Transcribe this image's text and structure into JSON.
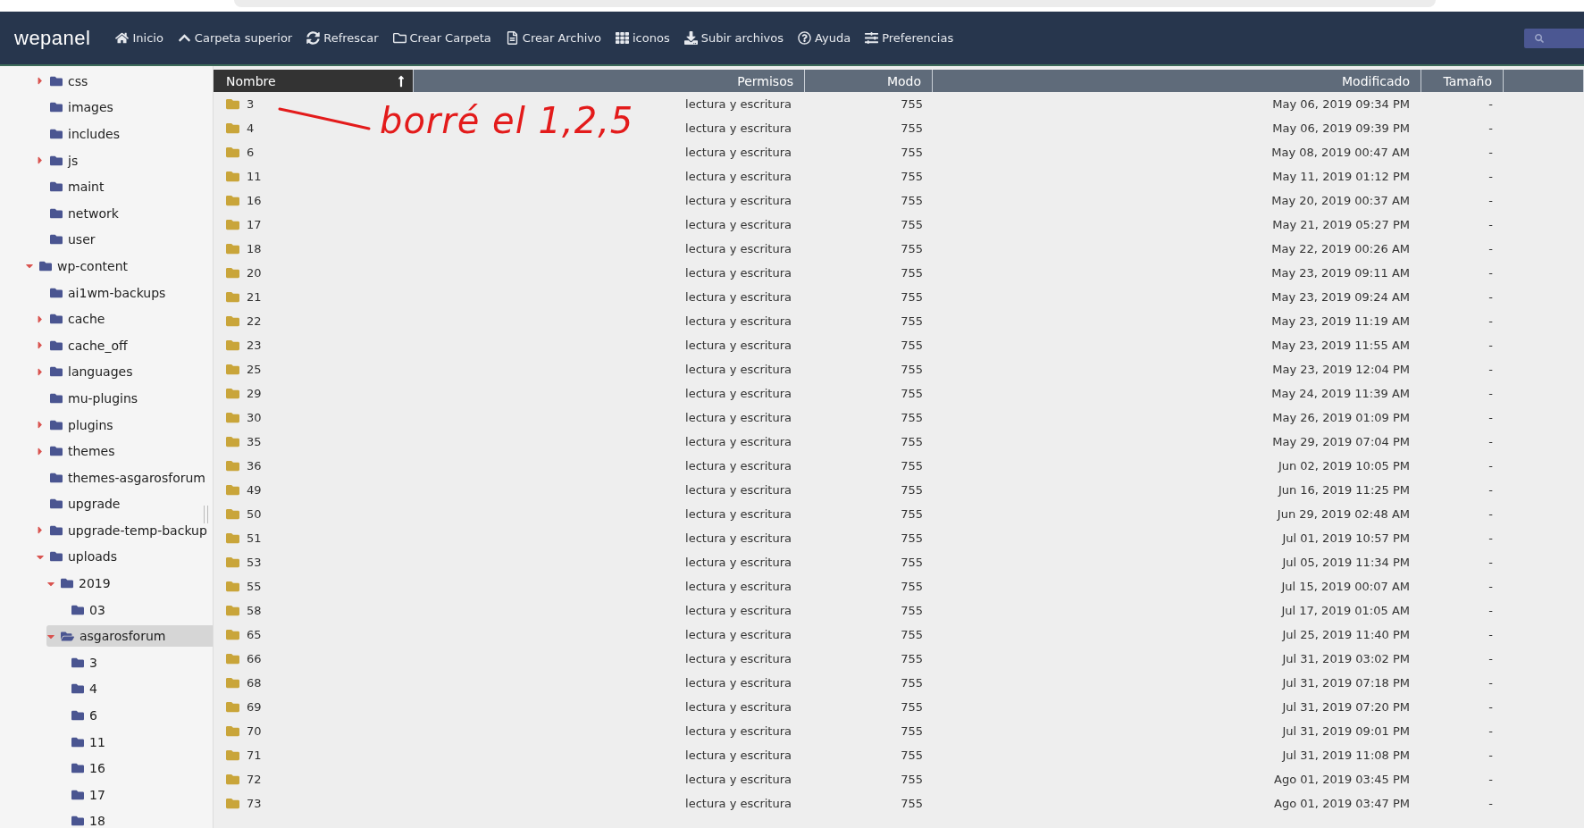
{
  "app": {
    "logo": "wepanel",
    "toolbar": [
      {
        "label": "Inicio"
      },
      {
        "label": "Carpeta superior"
      },
      {
        "label": "Refrescar"
      },
      {
        "label": "Crear Carpeta"
      },
      {
        "label": "Crear Archivo"
      },
      {
        "label": "iconos"
      },
      {
        "label": "Subir archivos"
      },
      {
        "label": "Ayuda"
      },
      {
        "label": "Preferencias"
      }
    ]
  },
  "tree": [
    {
      "children": [
        {
          "label": "css",
          "expandable": true,
          "expanded": false,
          "selected": false
        },
        {
          "label": "images",
          "expandable": false,
          "selected": false
        },
        {
          "label": "includes",
          "expandable": false,
          "selected": false
        },
        {
          "label": "js",
          "expandable": true,
          "expanded": false,
          "selected": false
        },
        {
          "label": "maint",
          "expandable": false,
          "selected": false
        },
        {
          "label": "network",
          "expandable": false,
          "selected": false
        },
        {
          "label": "user",
          "expandable": false,
          "selected": false
        }
      ]
    },
    {
      "label": "wp-content",
      "expandable": true,
      "expanded": true,
      "selected": false,
      "children": [
        {
          "label": "ai1wm-backups",
          "expandable": false,
          "selected": false
        },
        {
          "label": "cache",
          "expandable": true,
          "expanded": false,
          "selected": false
        },
        {
          "label": "cache_off",
          "expandable": true,
          "expanded": false,
          "selected": false
        },
        {
          "label": "languages",
          "expandable": true,
          "expanded": false,
          "selected": false
        },
        {
          "label": "mu-plugins",
          "expandable": false,
          "selected": false
        },
        {
          "label": "plugins",
          "expandable": true,
          "expanded": false,
          "selected": false
        },
        {
          "label": "themes",
          "expandable": true,
          "expanded": false,
          "selected": false
        },
        {
          "label": "themes-asgarosforum",
          "expandable": false,
          "selected": false
        },
        {
          "label": "upgrade",
          "expandable": false,
          "selected": false
        },
        {
          "label": "upgrade-temp-backup",
          "expandable": true,
          "expanded": false,
          "selected": false
        },
        {
          "label": "uploads",
          "expandable": true,
          "expanded": true,
          "selected": false,
          "children": [
            {
              "label": "2019",
              "expandable": true,
              "expanded": true,
              "selected": false,
              "children": [
                {
                  "label": "03",
                  "expandable": false,
                  "selected": false
                }
              ]
            },
            {
              "label": "asgarosforum",
              "expandable": true,
              "expanded": true,
              "selected": true,
              "children": [
                {
                  "label": "3",
                  "expandable": false,
                  "selected": false
                },
                {
                  "label": "4",
                  "expandable": false,
                  "selected": false
                },
                {
                  "label": "6",
                  "expandable": false,
                  "selected": false
                },
                {
                  "label": "11",
                  "expandable": false,
                  "selected": false
                },
                {
                  "label": "16",
                  "expandable": false,
                  "selected": false
                },
                {
                  "label": "17",
                  "expandable": false,
                  "selected": false
                },
                {
                  "label": "18",
                  "expandable": false,
                  "selected": false
                }
              ]
            }
          ]
        }
      ]
    }
  ],
  "table": {
    "columns": [
      {
        "label": "Nombre",
        "sorted": true
      },
      {
        "label": "Permisos",
        "sorted": false
      },
      {
        "label": "Modo",
        "sorted": false
      },
      {
        "label": "Modificado",
        "sorted": false
      },
      {
        "label": "Tamaño",
        "sorted": false
      }
    ],
    "rows": [
      [
        "3",
        "lectura y escritura",
        "755",
        "May 06, 2019 09:34 PM",
        "-"
      ],
      [
        "4",
        "lectura y escritura",
        "755",
        "May 06, 2019 09:39 PM",
        "-"
      ],
      [
        "6",
        "lectura y escritura",
        "755",
        "May 08, 2019 00:47 AM",
        "-"
      ],
      [
        "11",
        "lectura y escritura",
        "755",
        "May 11, 2019 01:12 PM",
        "-"
      ],
      [
        "16",
        "lectura y escritura",
        "755",
        "May 20, 2019 00:37 AM",
        "-"
      ],
      [
        "17",
        "lectura y escritura",
        "755",
        "May 21, 2019 05:27 PM",
        "-"
      ],
      [
        "18",
        "lectura y escritura",
        "755",
        "May 22, 2019 00:26 AM",
        "-"
      ],
      [
        "20",
        "lectura y escritura",
        "755",
        "May 23, 2019 09:11 AM",
        "-"
      ],
      [
        "21",
        "lectura y escritura",
        "755",
        "May 23, 2019 09:24 AM",
        "-"
      ],
      [
        "22",
        "lectura y escritura",
        "755",
        "May 23, 2019 11:19 AM",
        "-"
      ],
      [
        "23",
        "lectura y escritura",
        "755",
        "May 23, 2019 11:55 AM",
        "-"
      ],
      [
        "25",
        "lectura y escritura",
        "755",
        "May 23, 2019 12:04 PM",
        "-"
      ],
      [
        "29",
        "lectura y escritura",
        "755",
        "May 24, 2019 11:39 AM",
        "-"
      ],
      [
        "30",
        "lectura y escritura",
        "755",
        "May 26, 2019 01:09 PM",
        "-"
      ],
      [
        "35",
        "lectura y escritura",
        "755",
        "May 29, 2019 07:04 PM",
        "-"
      ],
      [
        "36",
        "lectura y escritura",
        "755",
        "Jun 02, 2019 10:05 PM",
        "-"
      ],
      [
        "49",
        "lectura y escritura",
        "755",
        "Jun 16, 2019 11:25 PM",
        "-"
      ],
      [
        "50",
        "lectura y escritura",
        "755",
        "Jun 29, 2019 02:48 AM",
        "-"
      ],
      [
        "51",
        "lectura y escritura",
        "755",
        "Jul 01, 2019 10:57 PM",
        "-"
      ],
      [
        "53",
        "lectura y escritura",
        "755",
        "Jul 05, 2019 11:34 PM",
        "-"
      ],
      [
        "55",
        "lectura y escritura",
        "755",
        "Jul 15, 2019 00:07 AM",
        "-"
      ],
      [
        "58",
        "lectura y escritura",
        "755",
        "Jul 17, 2019 01:05 AM",
        "-"
      ],
      [
        "65",
        "lectura y escritura",
        "755",
        "Jul 25, 2019 11:40 PM",
        "-"
      ],
      [
        "66",
        "lectura y escritura",
        "755",
        "Jul 31, 2019 03:02 PM",
        "-"
      ],
      [
        "68",
        "lectura y escritura",
        "755",
        "Jul 31, 2019 07:18 PM",
        "-"
      ],
      [
        "69",
        "lectura y escritura",
        "755",
        "Jul 31, 2019 07:20 PM",
        "-"
      ],
      [
        "70",
        "lectura y escritura",
        "755",
        "Jul 31, 2019 09:01 PM",
        "-"
      ],
      [
        "71",
        "lectura y escritura",
        "755",
        "Jul 31, 2019 11:08 PM",
        "-"
      ],
      [
        "72",
        "lectura y escritura",
        "755",
        "Ago 01, 2019 03:45 PM",
        "-"
      ],
      [
        "73",
        "lectura y escritura",
        "755",
        "Ago 01, 2019 03:47 PM",
        "-"
      ]
    ]
  },
  "annotation": {
    "text": "borré el 1,2,5"
  }
}
